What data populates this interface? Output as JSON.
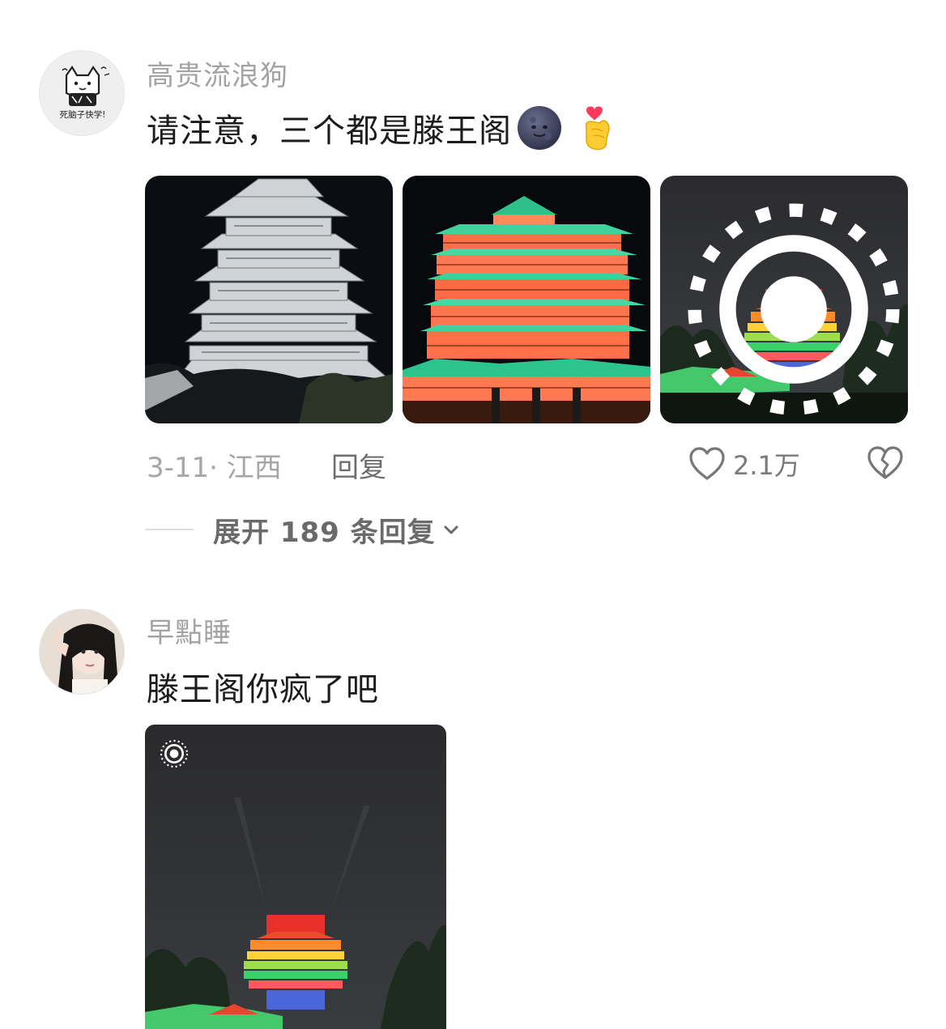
{
  "comments": [
    {
      "username": "高贵流浪狗",
      "avatar_text": "死脑子快学!",
      "text": "请注意，三个都是滕王阁",
      "emojis": [
        "new-moon-face",
        "finger-heart"
      ],
      "date": "3-11",
      "location": "江西",
      "reply_label": "回复",
      "like_count": "2.1万",
      "expand_label": "展开 189 条回复",
      "photos": [
        {
          "name": "tower-night-white",
          "live": false
        },
        {
          "name": "tower-night-colorful",
          "live": false
        },
        {
          "name": "tower-rainbow-live",
          "live": true
        }
      ]
    },
    {
      "username": "早點睡",
      "text": "滕王阁你疯了吧",
      "photos": [
        {
          "name": "tower-rainbow-live-large",
          "live": true
        }
      ]
    }
  ],
  "colors": {
    "username": "#a3a3a3",
    "text": "#1c1c1c",
    "meta": "#a6a6a6",
    "action": "#6e6e6e"
  }
}
